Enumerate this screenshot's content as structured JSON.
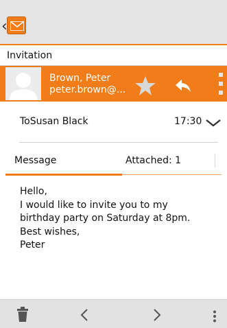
{
  "header": {
    "icons": {
      "back": "chevron-left-icon",
      "app": "mail-envelope-icon"
    },
    "accent_color": "#f07d1a"
  },
  "email": {
    "subject": "Invitation",
    "sender_name": "Brown, Peter",
    "sender_email": "peter.brown@...",
    "to_line": "ToSusan Black",
    "time": "17:30",
    "tabs": [
      {
        "label": "Message",
        "active": true
      },
      {
        "label": "Attached: 1",
        "active": false
      }
    ],
    "body_lines": [
      "Hello,",
      "I would like to invite you to my",
      "birthday party on Saturday at 8pm.",
      "Best wishes,",
      "Peter"
    ]
  },
  "sender_actions": {
    "icons": [
      "star-icon",
      "reply-icon",
      "more-vertical-icon"
    ]
  },
  "footer": {
    "icons": [
      "trash-icon",
      "chevron-left-icon",
      "chevron-right-icon",
      "more-vertical-icon"
    ]
  }
}
